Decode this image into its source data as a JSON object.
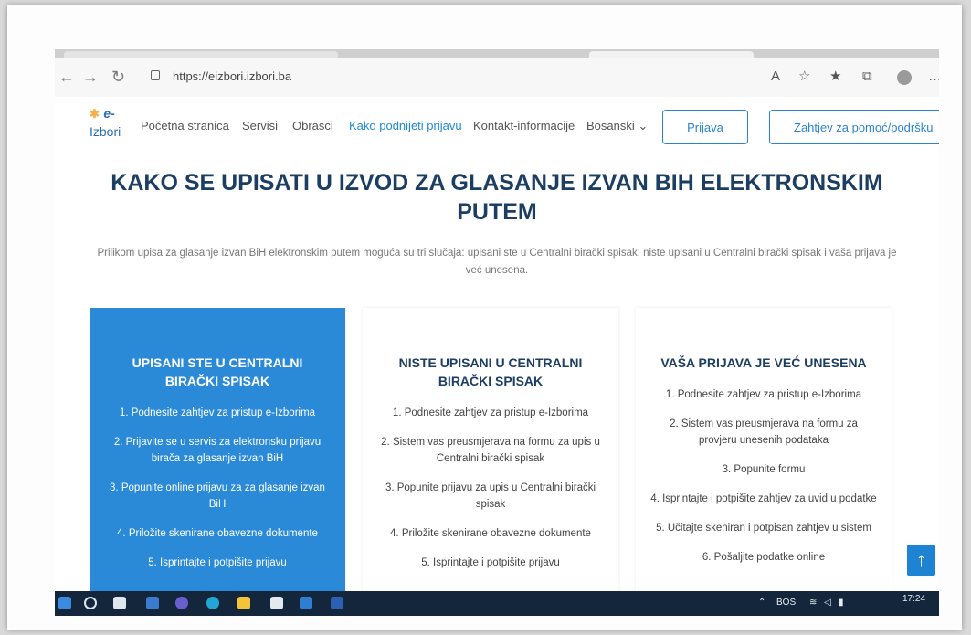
{
  "browser": {
    "url": "https://eizbori.izbori.ba",
    "icons": [
      "back-arrow-icon",
      "forward-arrow-icon",
      "refresh-icon",
      "lock-icon",
      "read-aloud-icon",
      "add-favorite-icon",
      "favorites-icon",
      "collections-icon",
      "profile-icon",
      "more-icon"
    ]
  },
  "header": {
    "logo_mark": "✱",
    "logo_e": "e-",
    "logo_text": "Izbori",
    "nav": [
      "Početna stranica",
      "Servisi",
      "Obrasci",
      "Kako podnijeti prijavu",
      "Kontakt-informacije",
      "Bosanski"
    ],
    "active_nav": "Kako podnijeti prijavu",
    "login_button": "Prijava",
    "help_button": "Zahtjev za pomoć/podršku"
  },
  "page": {
    "title_line1": "KAKO SE UPISATI U IZVOD ZA GLASANJE IZVAN BIH ELEKTRONSKIM",
    "title_line2": "PUTEM",
    "intro_line1": "Prilikom upisa za glasanje izvan BiH elektronskim putem moguća su tri slučaja: upisani ste u Centralni birački spisak; niste upisani u Centralni birački spisak i vaša prijava je",
    "intro_line2": "već unesena."
  },
  "cards": [
    {
      "title_line1": "UPISANI STE U CENTRALNI",
      "title_line2": "BIRAČKI SPISAK",
      "steps": [
        "1. Podnesite zahtjev za pristup e-Izborima",
        "2. Prijavite se u servis za elektronsku prijavu birača za glasanje izvan BiH",
        "3. Popunite online prijavu za za glasanje izvan BiH",
        "4. Priložite skenirane obavezne dokumente",
        "5. Isprintajte i potpišite prijavu"
      ]
    },
    {
      "title_line1": "NISTE UPISANI U CENTRALNI",
      "title_line2": "BIRAČKI SPISAK",
      "steps": [
        "1. Podnesite zahtjev za pristup e-Izborima",
        "2. Sistem vas preusmjerava na formu za upis u Centralni birački spisak",
        "3. Popunite prijavu za upis u Centralni birački spisak",
        "4. Priložite skenirane obavezne dokumente",
        "5. Isprintajte i potpišite prijavu"
      ]
    },
    {
      "title_line1": "VAŠA PRIJAVA JE VEĆ UNESENA",
      "title_line2": "",
      "steps": [
        "1. Podnesite zahtjev za pristup e-Izborima",
        "2. Sistem vas preusmjerava na formu za provjeru unesenih podataka",
        "3. Popunite formu",
        "4. Isprintajte i potpišite zahtjev za uvid u podatke",
        "5. Učitajte skeniran i potpisan zahtjev u sistem",
        "6. Pošaljite podatke online"
      ]
    }
  ],
  "taskbar": {
    "language": "BOS",
    "time": "17:24",
    "icons": [
      "windows-start-icon",
      "search-icon",
      "task-view-icon",
      "widgets-icon",
      "chat-icon",
      "edge-icon",
      "file-explorer-icon",
      "store-icon",
      "mail-icon",
      "word-icon",
      "chevron-up-icon",
      "wifi-icon",
      "volume-icon",
      "battery-icon"
    ]
  },
  "colors": {
    "primary": "#2a8ad8",
    "heading": "#1c3e63",
    "taskbar": "#14263b"
  }
}
